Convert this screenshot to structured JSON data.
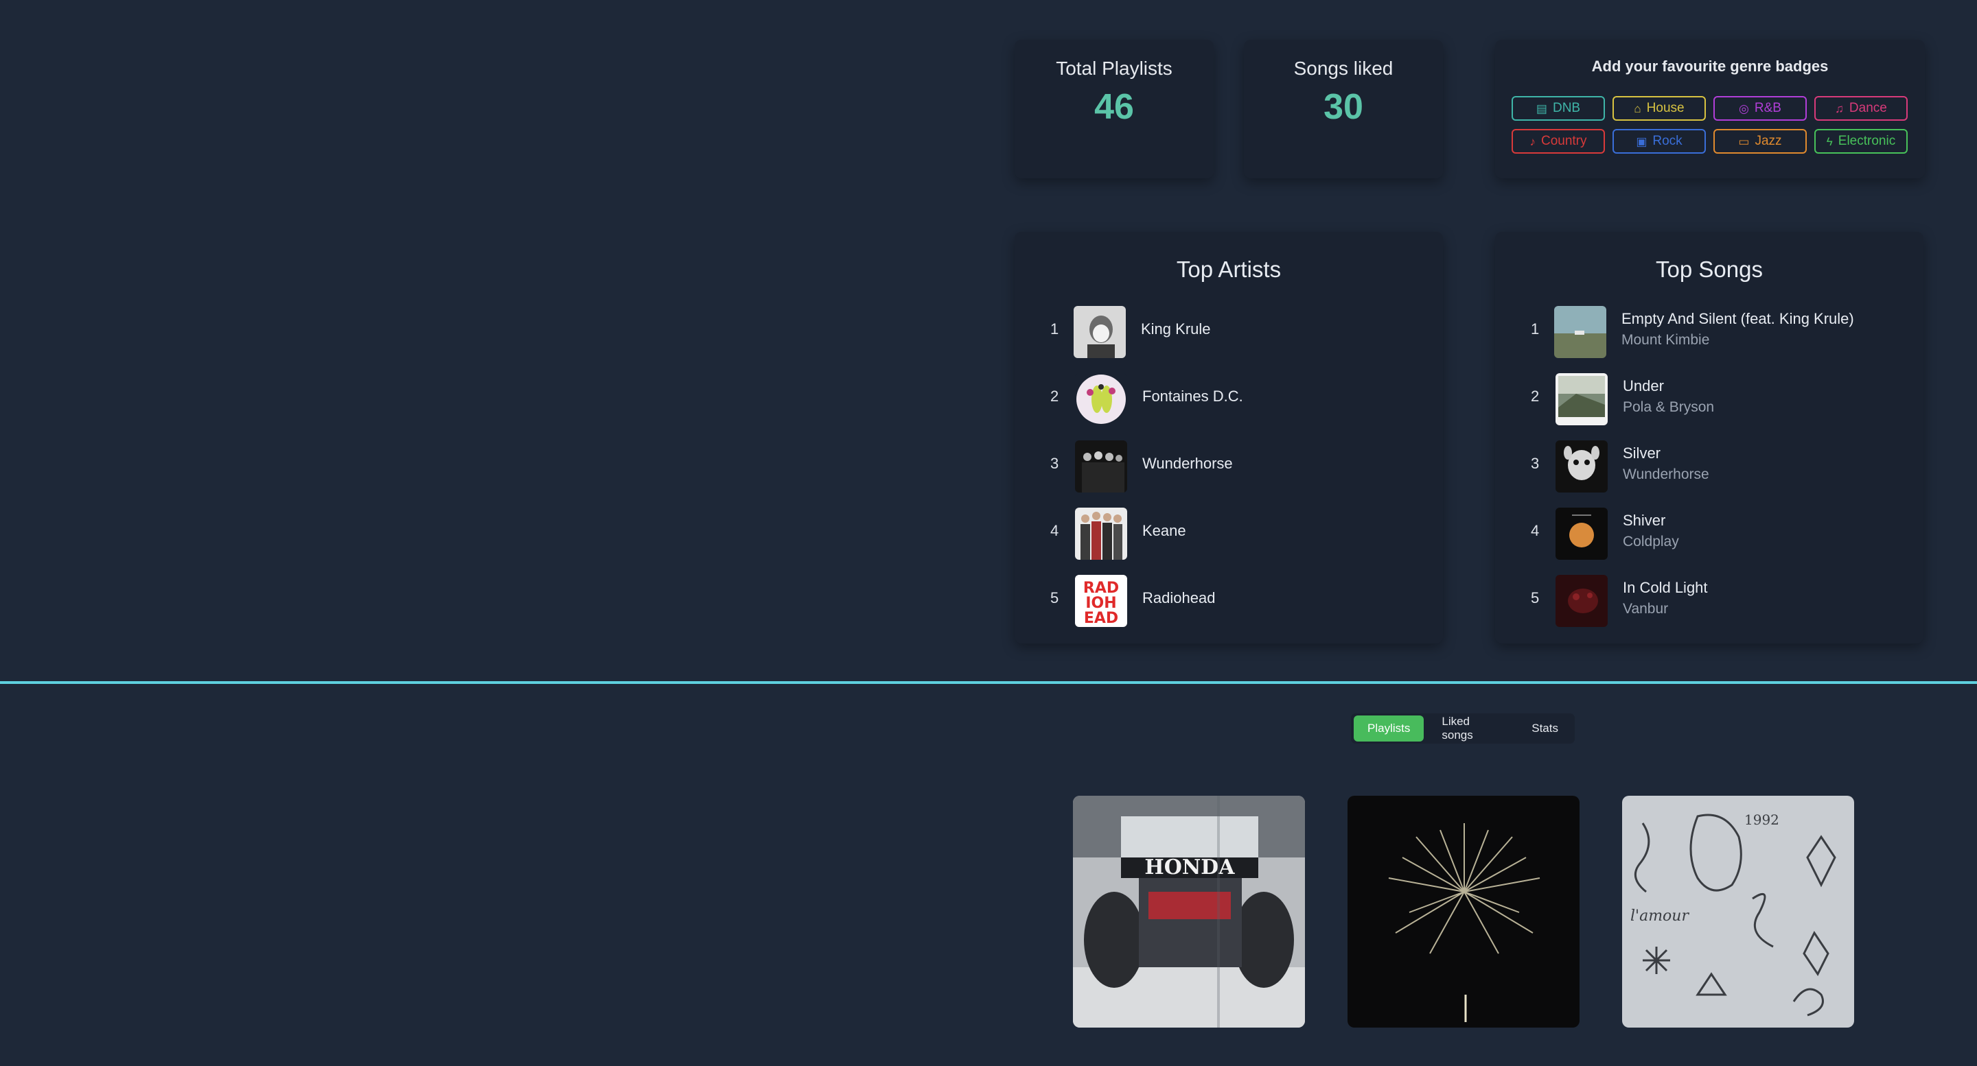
{
  "stats": {
    "playlists_label": "Total Playlists",
    "playlists_value": "46",
    "liked_label": "Songs liked",
    "liked_value": "30"
  },
  "badges": {
    "title": "Add your favourite genre badges",
    "items": [
      {
        "label": "DNB",
        "color": "#3fb5a8",
        "icon": "drum-icon"
      },
      {
        "label": "House",
        "color": "#d8c341",
        "icon": "home-icon"
      },
      {
        "label": "R&B",
        "color": "#b13ed8",
        "icon": "vinyl-icon"
      },
      {
        "label": "Dance",
        "color": "#d83a7a",
        "icon": "dancer-icon"
      },
      {
        "label": "Country",
        "color": "#d83a3a",
        "icon": "guitar-icon"
      },
      {
        "label": "Rock",
        "color": "#3a6ed8",
        "icon": "speaker-icon"
      },
      {
        "label": "Jazz",
        "color": "#e08a2e",
        "icon": "piano-icon"
      },
      {
        "label": "Electronic",
        "color": "#48c25a",
        "icon": "bolt-icon"
      }
    ]
  },
  "top_artists": {
    "title": "Top Artists",
    "items": [
      {
        "rank": "1",
        "name": "King Krule"
      },
      {
        "rank": "2",
        "name": "Fontaines D.C."
      },
      {
        "rank": "3",
        "name": "Wunderhorse"
      },
      {
        "rank": "4",
        "name": "Keane"
      },
      {
        "rank": "5",
        "name": "Radiohead"
      }
    ]
  },
  "top_songs": {
    "title": "Top Songs",
    "items": [
      {
        "rank": "1",
        "title": "Empty And Silent (feat. King Krule)",
        "artist": "Mount Kimbie"
      },
      {
        "rank": "2",
        "title": "Under",
        "artist": "Pola & Bryson"
      },
      {
        "rank": "3",
        "title": "Silver",
        "artist": "Wunderhorse"
      },
      {
        "rank": "4",
        "title": "Shiver",
        "artist": "Coldplay"
      },
      {
        "rank": "5",
        "title": "In Cold Light",
        "artist": "Vanbur"
      }
    ]
  },
  "tabs": [
    {
      "label": "Playlists",
      "active": true
    },
    {
      "label": "Liked songs",
      "active": false
    },
    {
      "label": "Stats",
      "active": false
    }
  ],
  "playlist_cover_1": {
    "logo_text": "HONDA"
  },
  "playlist_cover_3": {
    "year_text": "1992",
    "script_text": "l'amour"
  },
  "radiohead_logo": [
    "RAD",
    "IOH",
    "EAD"
  ]
}
